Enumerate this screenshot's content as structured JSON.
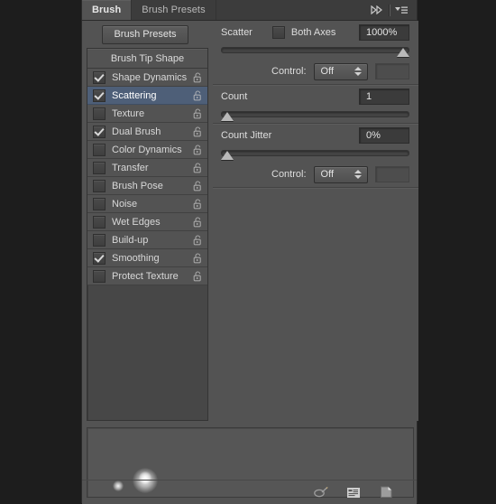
{
  "panel": {
    "tabs": [
      {
        "label": "Brush",
        "active": true
      },
      {
        "label": "Brush Presets",
        "active": false
      }
    ],
    "collapse_icon": "double-chevron-right-icon",
    "menu_icon": "panel-menu-icon"
  },
  "presets_button": {
    "label": "Brush Presets"
  },
  "brush_list": {
    "header": "Brush Tip Shape",
    "items": [
      {
        "label": "Shape Dynamics",
        "checked": true,
        "selected": false
      },
      {
        "label": "Scattering",
        "checked": true,
        "selected": true
      },
      {
        "label": "Texture",
        "checked": false,
        "selected": false
      },
      {
        "label": "Dual Brush",
        "checked": true,
        "selected": false
      },
      {
        "label": "Color Dynamics",
        "checked": false,
        "selected": false
      },
      {
        "label": "Transfer",
        "checked": false,
        "selected": false
      },
      {
        "label": "Brush Pose",
        "checked": false,
        "selected": false
      },
      {
        "label": "Noise",
        "checked": false,
        "selected": false
      },
      {
        "label": "Wet Edges",
        "checked": false,
        "selected": false
      },
      {
        "label": "Build-up",
        "checked": false,
        "selected": false
      },
      {
        "label": "Smoothing",
        "checked": true,
        "selected": false
      },
      {
        "label": "Protect Texture",
        "checked": false,
        "selected": false
      }
    ],
    "lock_icon": "unlocked-padlock-icon"
  },
  "options": {
    "scatter": {
      "label": "Scatter",
      "both_axes_label": "Both Axes",
      "both_axes_checked": false,
      "value": "1000%",
      "slider_percent": 100,
      "control_label": "Control:",
      "control_value": "Off"
    },
    "count": {
      "label": "Count",
      "value": "1",
      "slider_percent": 0
    },
    "count_jitter": {
      "label": "Count Jitter",
      "value": "0%",
      "slider_percent": 0,
      "control_label": "Control:",
      "control_value": "Off"
    }
  },
  "preview": {
    "name": "brush-stroke-preview"
  },
  "bottom_bar": {
    "icons": [
      {
        "name": "toggle-brush-panel-icon"
      },
      {
        "name": "create-new-brush-preset-icon"
      },
      {
        "name": "new-brush-icon"
      }
    ]
  },
  "colors": {
    "panel_bg": "#535353",
    "tab_bg": "#3c3c3c",
    "selection": "#4e5f78",
    "field_bg": "#3b3b3b",
    "outer_bg": "#1d1d1d"
  }
}
